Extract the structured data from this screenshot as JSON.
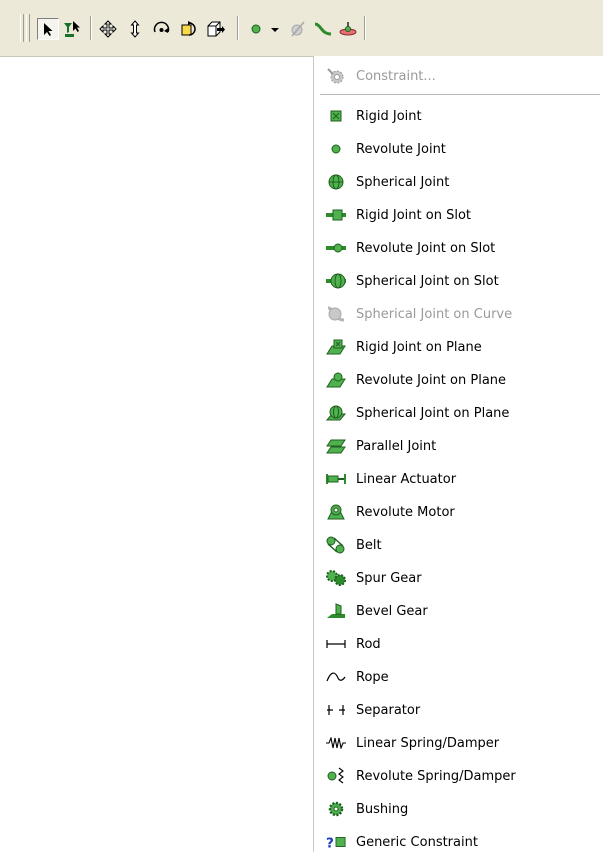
{
  "toolbar": {
    "buttons": [
      {
        "icon": "select-arrow-icon",
        "pressed": true
      },
      {
        "icon": "filter-select-icon",
        "pressed": false
      },
      {
        "icon": "move-icon",
        "pressed": false
      },
      {
        "icon": "move-vertical-icon",
        "pressed": false
      },
      {
        "icon": "rotate-icon",
        "pressed": false
      },
      {
        "icon": "rotate-part-icon",
        "pressed": false
      },
      {
        "icon": "move-part-icon",
        "pressed": false
      },
      {
        "icon": "revolute-joint-icon",
        "pressed": false
      },
      {
        "icon": "dropdown-arrow-icon",
        "pressed": false
      },
      {
        "icon": "constraint-disabled-icon",
        "pressed": false
      },
      {
        "icon": "green-curve-icon",
        "pressed": false
      },
      {
        "icon": "ground-joint-icon",
        "pressed": false
      }
    ]
  },
  "menu": {
    "items": [
      {
        "label": "Constraint...",
        "icon": "constraint-gear-icon",
        "disabled": true
      },
      {
        "label": "Rigid Joint",
        "icon": "rigid-joint-icon",
        "disabled": false
      },
      {
        "label": "Revolute Joint",
        "icon": "revolute-joint-icon",
        "disabled": false
      },
      {
        "label": "Spherical Joint",
        "icon": "spherical-joint-icon",
        "disabled": false
      },
      {
        "label": "Rigid Joint on Slot",
        "icon": "rigid-joint-slot-icon",
        "disabled": false
      },
      {
        "label": "Revolute Joint on Slot",
        "icon": "revolute-joint-slot-icon",
        "disabled": false
      },
      {
        "label": "Spherical Joint on Slot",
        "icon": "spherical-joint-slot-icon",
        "disabled": false
      },
      {
        "label": "Spherical Joint on Curve",
        "icon": "spherical-joint-curve-icon",
        "disabled": true
      },
      {
        "label": "Rigid Joint on Plane",
        "icon": "rigid-joint-plane-icon",
        "disabled": false
      },
      {
        "label": "Revolute Joint on Plane",
        "icon": "revolute-joint-plane-icon",
        "disabled": false
      },
      {
        "label": "Spherical Joint on Plane",
        "icon": "spherical-joint-plane-icon",
        "disabled": false
      },
      {
        "label": "Parallel Joint",
        "icon": "parallel-joint-icon",
        "disabled": false
      },
      {
        "label": "Linear Actuator",
        "icon": "linear-actuator-icon",
        "disabled": false
      },
      {
        "label": "Revolute Motor",
        "icon": "revolute-motor-icon",
        "disabled": false
      },
      {
        "label": "Belt",
        "icon": "belt-icon",
        "disabled": false
      },
      {
        "label": "Spur Gear",
        "icon": "spur-gear-icon",
        "disabled": false
      },
      {
        "label": "Bevel Gear",
        "icon": "bevel-gear-icon",
        "disabled": false
      },
      {
        "label": "Rod",
        "icon": "rod-icon",
        "disabled": false
      },
      {
        "label": "Rope",
        "icon": "rope-icon",
        "disabled": false
      },
      {
        "label": "Separator",
        "icon": "separator-icon",
        "disabled": false
      },
      {
        "label": "Linear Spring/Damper",
        "icon": "linear-spring-icon",
        "disabled": false
      },
      {
        "label": "Revolute Spring/Damper",
        "icon": "revolute-spring-icon",
        "disabled": false
      },
      {
        "label": "Bushing",
        "icon": "bushing-icon",
        "disabled": false
      },
      {
        "label": "Generic Constraint",
        "icon": "generic-constraint-icon",
        "disabled": false
      }
    ]
  }
}
